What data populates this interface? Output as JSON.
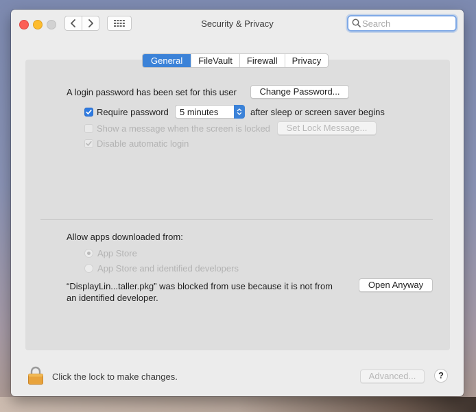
{
  "window": {
    "title": "Security & Privacy"
  },
  "toolbar": {
    "search_placeholder": "Search"
  },
  "tabs": [
    {
      "label": "General",
      "active": true
    },
    {
      "label": "FileVault",
      "active": false
    },
    {
      "label": "Firewall",
      "active": false
    },
    {
      "label": "Privacy",
      "active": false
    }
  ],
  "general": {
    "login_text": "A login password has been set for this user",
    "change_password_label": "Change Password...",
    "require_password_label": "Require password",
    "require_password_checked": true,
    "require_password_delay": "5 minutes",
    "after_sleep_text": "after sleep or screen saver begins",
    "show_message_label": "Show a message when the screen is locked",
    "show_message_checked": false,
    "set_lock_message_label": "Set Lock Message...",
    "disable_auto_login_label": "Disable automatic login",
    "disable_auto_login_checked": true
  },
  "downloads": {
    "heading": "Allow apps downloaded from:",
    "options": [
      {
        "label": "App Store",
        "selected": true
      },
      {
        "label": "App Store and identified developers",
        "selected": false
      }
    ],
    "blocked_line1": "“DisplayLin...taller.pkg” was blocked from use because it is not from",
    "blocked_line2": "an identified developer.",
    "open_anyway_label": "Open Anyway"
  },
  "footer": {
    "lock_text": "Click the lock to make changes.",
    "advanced_label": "Advanced...",
    "help_label": "?"
  },
  "icons": {
    "back": "chevron-left-icon",
    "forward": "chevron-right-icon",
    "grid": "grid-icon",
    "search": "search-icon",
    "lock": "lock-icon",
    "checkbox": "checkmark-icon"
  },
  "colors": {
    "accent": "#3b82d8",
    "close": "#fc5f57",
    "minimize": "#fdbc2e",
    "lock": "#e8a33c"
  }
}
